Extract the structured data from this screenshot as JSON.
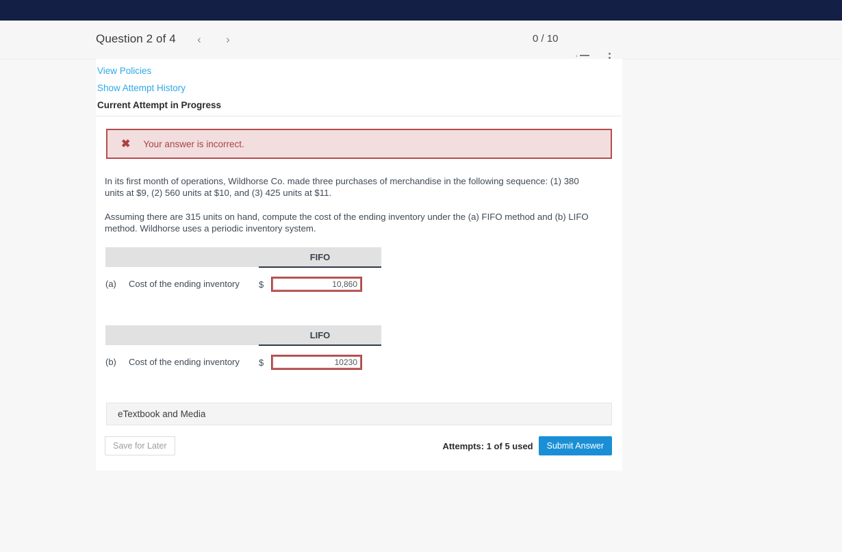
{
  "header": {
    "question_title": "Question 2 of 4",
    "prev_label": "‹",
    "next_label": "›",
    "score": "0 / 10",
    "list_icon": "numbered-list-icon",
    "menu_icon": "kebab-menu-icon"
  },
  "links": {
    "view_policies": "View Policies",
    "show_attempt_history": "Show Attempt History",
    "current_attempt": "Current Attempt in Progress"
  },
  "alert": {
    "icon": "cross-mark-icon",
    "glyph": "✖",
    "message": "Your answer is incorrect.",
    "bg": "#f2dede",
    "border": "#b54c4c",
    "text_color": "#a94442"
  },
  "question": {
    "paragraph1": "In its first month of operations, Wildhorse Co. made three purchases of merchandise in the following sequence: (1) 380 units at $9, (2) 560 units at $10, and (3) 425 units at $11.",
    "paragraph2": "Assuming there are 315 units on hand, compute the cost of the ending inventory under the (a) FIFO method and (b) LIFO method. Wildhorse uses a periodic inventory system."
  },
  "tables": [
    {
      "column_header": "FIFO",
      "index": "(a)",
      "description": "Cost of the ending inventory",
      "currency": "$",
      "value": "10,860",
      "placeholder": ""
    },
    {
      "column_header": "LIFO",
      "index": "(b)",
      "description": "Cost of the ending inventory",
      "currency": "$",
      "value": "10230",
      "placeholder": ""
    }
  ],
  "etextbook": {
    "label": "eTextbook and Media"
  },
  "footer": {
    "save_label": "Save for Later",
    "attempts": "Attempts: 1 of 5 used",
    "submit_label": "Submit Answer",
    "submit_color": "#1a8fd6"
  }
}
